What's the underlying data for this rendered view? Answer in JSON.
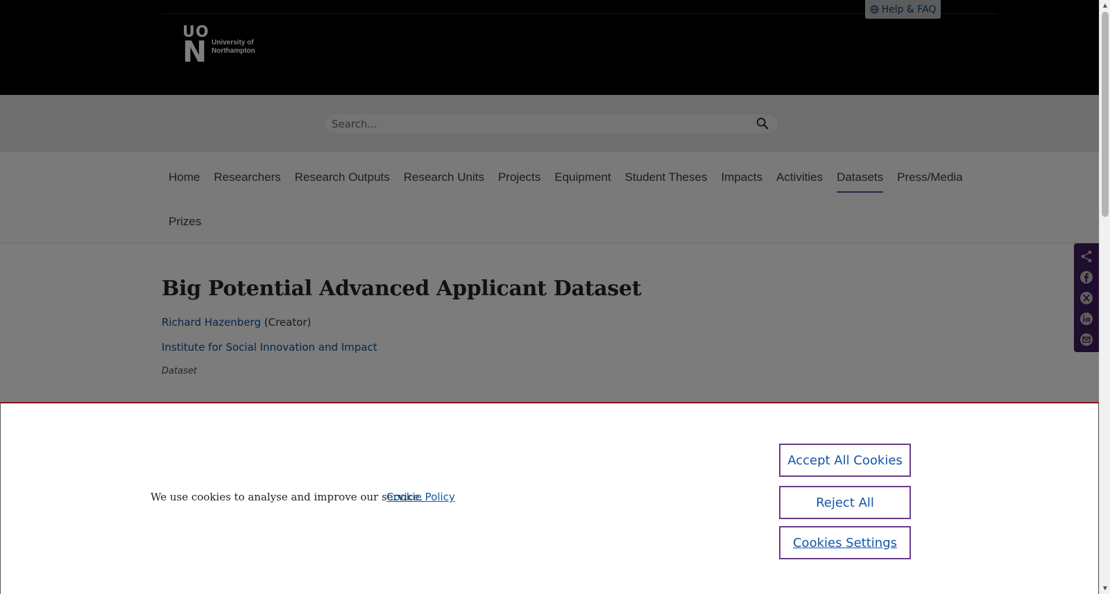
{
  "header": {
    "help_label": "Help & FAQ",
    "logo_mark_top": "UO",
    "logo_mark_bottom": "N",
    "logo_name": "University of Northampton"
  },
  "search": {
    "placeholder": "Search..."
  },
  "nav": {
    "items": [
      {
        "label": "Home"
      },
      {
        "label": "Researchers"
      },
      {
        "label": "Research Outputs"
      },
      {
        "label": "Research Units"
      },
      {
        "label": "Projects"
      },
      {
        "label": "Equipment"
      },
      {
        "label": "Student Theses"
      },
      {
        "label": "Impacts"
      },
      {
        "label": "Activities"
      },
      {
        "label": "Datasets",
        "active": true
      },
      {
        "label": "Press/Media"
      },
      {
        "label": "Prizes"
      }
    ]
  },
  "dataset": {
    "title": "Big Potential Advanced Applicant Dataset",
    "creator_name": "Richard Hazenberg",
    "creator_role": "(Creator)",
    "organisation": "Institute for Social Innovation and Impact",
    "type": "Dataset"
  },
  "share": {
    "icons": [
      "share-icon",
      "facebook-icon",
      "x-icon",
      "linkedin-icon",
      "email-icon"
    ]
  },
  "cookie": {
    "message": "We use cookies to analyse and improve our service.",
    "policy_link": "Cookie Policy",
    "accept_label": "Accept All Cookies",
    "reject_label": "Reject All",
    "settings_label": "Cookies Settings"
  },
  "colors": {
    "accent": "#6a3c8a",
    "link": "#0b4d8c",
    "header_bg": "#000000"
  }
}
